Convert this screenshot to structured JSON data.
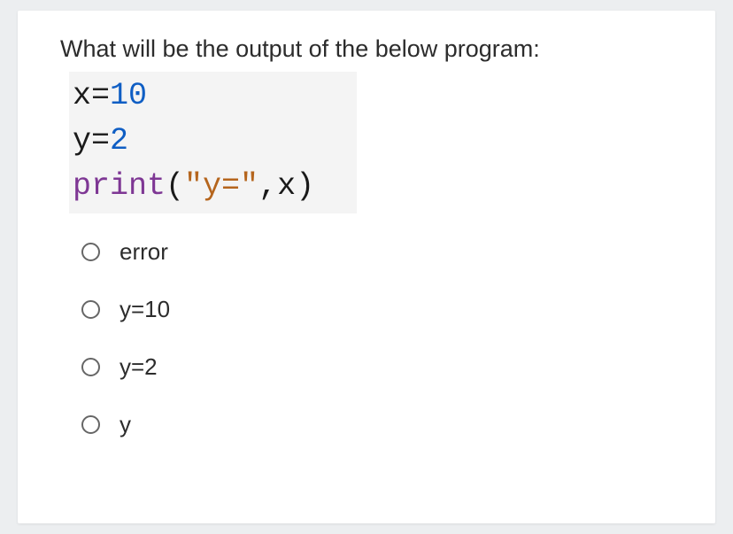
{
  "question": {
    "prompt": "What will be the output of the below program:",
    "code": {
      "line1": {
        "var": "x",
        "op": "=",
        "num": "10"
      },
      "line2": {
        "var": "y",
        "op": "=",
        "num": "2"
      },
      "line3": {
        "func": "print",
        "open": "(",
        "str": "\"y=\"",
        "comma": ",",
        "arg": "x",
        "close": ")"
      }
    },
    "options": [
      {
        "label": "error"
      },
      {
        "label": "y=10"
      },
      {
        "label": "y=2"
      },
      {
        "label": "y"
      }
    ]
  }
}
